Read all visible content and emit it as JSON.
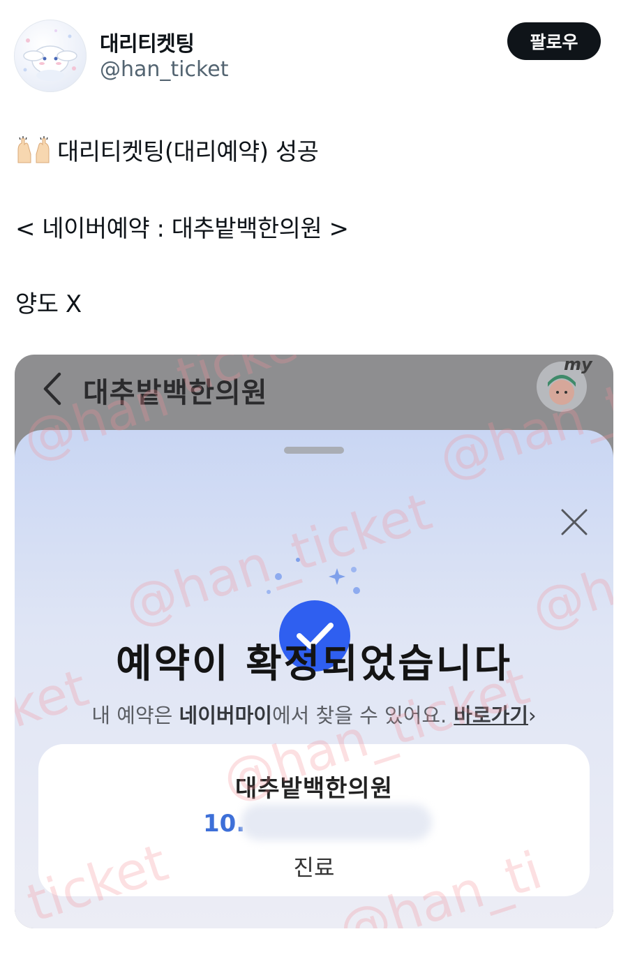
{
  "tweet": {
    "display_name": "대리티켓팅",
    "handle": "@han_ticket",
    "follow_label": "팔로우",
    "lines": [
      "대리티켓팅(대리예약) 성공",
      "< 네이버예약 : 대추밭백한의원 >",
      "양도 X"
    ],
    "emoji": "raising-hands-emoji"
  },
  "media": {
    "app_bar": {
      "title": "대추밭백한의원",
      "my_label": "my"
    },
    "sheet": {
      "confirm_title": "예약이 확정되었습니다",
      "sub_prefix": "내 예약은 ",
      "sub_bold": "네이버마이",
      "sub_suffix": "에서 찾을 수 있어요.",
      "shortcut_label": "바로가기",
      "chevron": "›"
    },
    "card": {
      "title": "대추밭백한의원",
      "date_prefix": "10.",
      "type": "진료"
    },
    "watermark_text": "@han_ticket",
    "watermark_visible": [
      "ticket",
      "@han",
      "@han_ticket",
      "@ha",
      "ket",
      "@han_ticket",
      "_ticket",
      "_ticket",
      "@han_ti"
    ]
  },
  "colors": {
    "follow_bg": "#0f1419",
    "accent_blue": "#3d6fd8",
    "check_blue": "#2f5ff0",
    "watermark": "#f49098"
  }
}
